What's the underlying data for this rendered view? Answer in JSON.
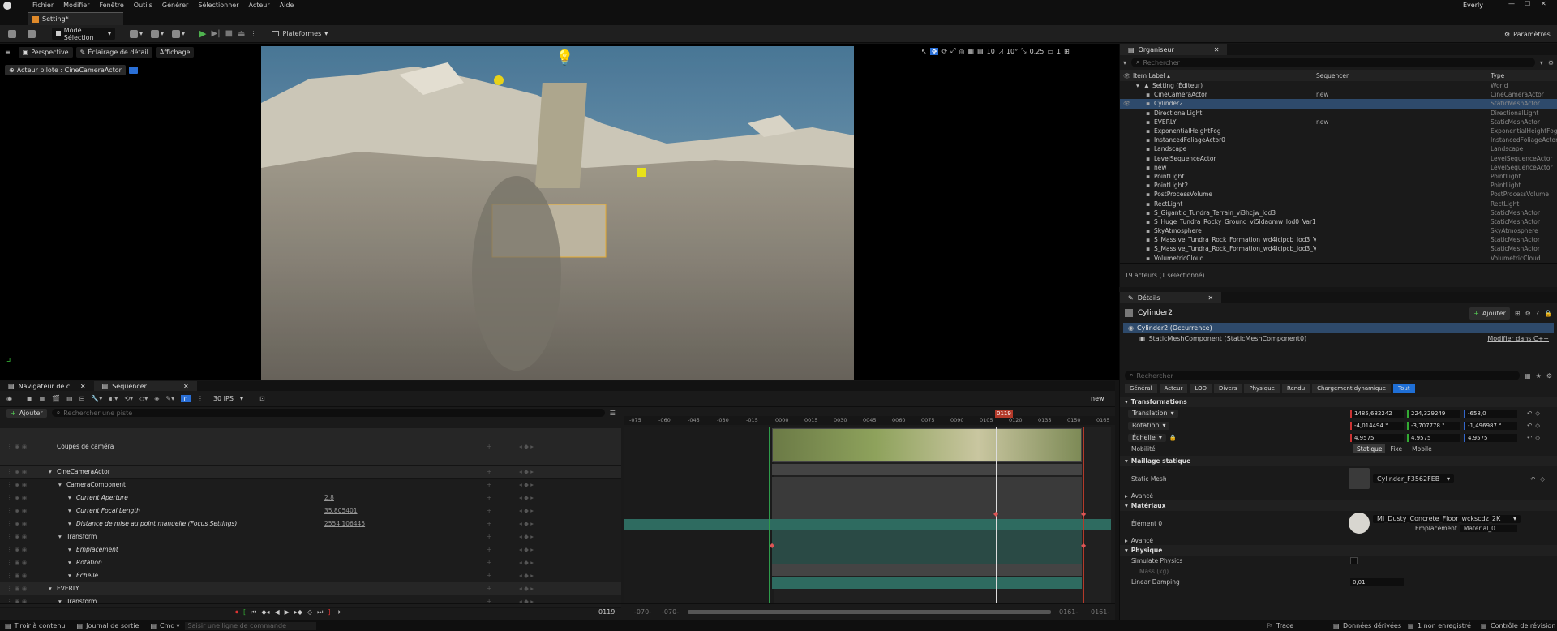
{
  "menu": [
    "Fichier",
    "Modifier",
    "Fenêtre",
    "Outils",
    "Générer",
    "Sélectionner",
    "Acteur",
    "Aide"
  ],
  "project_name": "Everly",
  "tab": {
    "label": "Setting*"
  },
  "toolbar": {
    "mode": "Mode Sélection",
    "platforms": "Plateformes",
    "settings": "Paramètres"
  },
  "viewport": {
    "perspective": "Perspective",
    "lighting": "Éclairage de détail",
    "show": "Affichage",
    "pilot": "Acteur pilote : CineCameraActor",
    "grid": "10",
    "angle": "10°",
    "scale": "0,25",
    "cams": "1"
  },
  "outliner": {
    "title": "Organiseur",
    "search_placeholder": "Rechercher",
    "columns": {
      "label": "Item Label ▴",
      "seq": "Sequencer",
      "type": "Type"
    },
    "root": {
      "label": "Setting (Éditeur)",
      "type": "World"
    },
    "items": [
      {
        "label": "CineCameraActor",
        "seq": "new",
        "type": "CineCameraActor"
      },
      {
        "label": "Cylinder2",
        "seq": "",
        "type": "StaticMeshActor",
        "selected": true
      },
      {
        "label": "DirectionalLight",
        "seq": "",
        "type": "DirectionalLight"
      },
      {
        "label": "EVERLY",
        "seq": "new",
        "type": "StaticMeshActor"
      },
      {
        "label": "ExponentialHeightFog",
        "seq": "",
        "type": "ExponentialHeightFog"
      },
      {
        "label": "InstancedFoliageActor0",
        "seq": "",
        "type": "InstancedFoliageActor"
      },
      {
        "label": "Landscape",
        "seq": "",
        "type": "Landscape"
      },
      {
        "label": "LevelSequenceActor",
        "seq": "",
        "type": "LevelSequenceActor"
      },
      {
        "label": "new",
        "seq": "",
        "type": "LevelSequenceActor"
      },
      {
        "label": "PointLight",
        "seq": "",
        "type": "PointLight"
      },
      {
        "label": "PointLight2",
        "seq": "",
        "type": "PointLight"
      },
      {
        "label": "PostProcessVolume",
        "seq": "",
        "type": "PostProcessVolume"
      },
      {
        "label": "RectLight",
        "seq": "",
        "type": "RectLight"
      },
      {
        "label": "S_Gigantic_Tundra_Terrain_vi3hcjw_lod3",
        "seq": "",
        "type": "StaticMeshActor"
      },
      {
        "label": "S_Huge_Tundra_Rocky_Ground_vi5ldaomw_lod0_Var1",
        "seq": "",
        "type": "StaticMeshActor"
      },
      {
        "label": "SkyAtmosphere",
        "seq": "",
        "type": "SkyAtmosphere"
      },
      {
        "label": "S_Massive_Tundra_Rock_Formation_wd4icipcb_lod3_Var",
        "seq": "",
        "type": "StaticMeshActor"
      },
      {
        "label": "S_Massive_Tundra_Rock_Formation_wd4icipcb_lod3_Var",
        "seq": "",
        "type": "StaticMeshActor"
      },
      {
        "label": "VolumetricCloud",
        "seq": "",
        "type": "VolumetricCloud"
      }
    ],
    "footer": "19 acteurs (1 sélectionné)"
  },
  "details": {
    "title": "Détails",
    "object": "Cylinder2",
    "add": "Ajouter",
    "instance": "Cylinder2 (Occurrence)",
    "component": "StaticMeshComponent (StaticMeshComponent0)",
    "edit_cpp": "Modifier dans C++",
    "search_placeholder": "Rechercher",
    "filters": [
      "Général",
      "Acteur",
      "LOD",
      "Divers",
      "Physique",
      "Rendu",
      "Chargement dynamique",
      "Tout"
    ],
    "transforms": "Transformations",
    "translation": {
      "label": "Translation",
      "x": "1485,682242",
      "y": "224,329249",
      "z": "-658,0"
    },
    "rotation": {
      "label": "Rotation",
      "x": "-4,014494 °",
      "y": "-3,707778 °",
      "z": "-1,496987 °"
    },
    "scale": {
      "label": "Échelle",
      "x": "4,9575",
      "y": "4,9575",
      "z": "4,9575"
    },
    "mobility": {
      "label": "Mobilité",
      "options": [
        "Statique",
        "Fixe",
        "Mobile"
      ]
    },
    "static_mesh_section": "Maillage statique",
    "static_mesh_label": "Static Mesh",
    "static_mesh_value": "Cylinder_F3562FEB",
    "advanced": "Avancé",
    "materials": "Matériaux",
    "element0": "Élément 0",
    "material_value": "MI_Dusty_Concrete_Floor_wckscdz_2K",
    "location_label": "Emplacement",
    "location_value": "Material_0",
    "physics": "Physique",
    "simulate": "Simulate Physics",
    "mass": "Mass (kg)",
    "linear_damping": "Linear Damping",
    "linear_damping_value": "0,01"
  },
  "sequencer": {
    "tabs": [
      "Navigateur de c...",
      "Sequencer"
    ],
    "fps": "30 IPS",
    "seq_name": "new",
    "add": "Ajouter",
    "search_placeholder": "Rechercher une piste",
    "current_frame": "0119",
    "start": "-070-",
    "start2": "-070-",
    "end": "0161-",
    "end2": "0161-",
    "ruler": [
      "-075",
      "-060",
      "-045",
      "-030",
      "-015",
      "0000",
      "0015",
      "0030",
      "0045",
      "0060",
      "0075",
      "0090",
      "0105",
      "0120",
      "0135",
      "0150",
      "0165"
    ],
    "tracks": [
      {
        "label": "Coupes de caméra",
        "value": "",
        "indent": 0
      },
      {
        "label": "CineCameraActor",
        "value": "",
        "indent": 0
      },
      {
        "label": "CameraComponent",
        "value": "",
        "indent": 1
      },
      {
        "label": "Current Aperture",
        "value": "2,8",
        "indent": 2
      },
      {
        "label": "Current Focal Length",
        "value": "35,805401",
        "indent": 2
      },
      {
        "label": "Distance de mise au point manuelle (Focus Settings)",
        "value": "2554,106445",
        "indent": 2
      },
      {
        "label": "Transform",
        "value": "",
        "indent": 1
      },
      {
        "label": "Emplacement",
        "value": "",
        "indent": 2
      },
      {
        "label": "Rotation",
        "value": "",
        "indent": 2
      },
      {
        "label": "Échelle",
        "value": "",
        "indent": 2
      },
      {
        "label": "EVERLY",
        "value": "",
        "indent": 0
      },
      {
        "label": "Transform",
        "value": "",
        "indent": 1
      }
    ]
  },
  "status": {
    "drawer": "Tiroir à contenu",
    "log": "Journal de sortie",
    "cmd": "Cmd",
    "cmd_placeholder": "Saisir une ligne de commande",
    "trace": "Trace",
    "derived": "Données dérivées",
    "unsaved": "1 non enregistré",
    "revision": "Contrôle de révision"
  }
}
